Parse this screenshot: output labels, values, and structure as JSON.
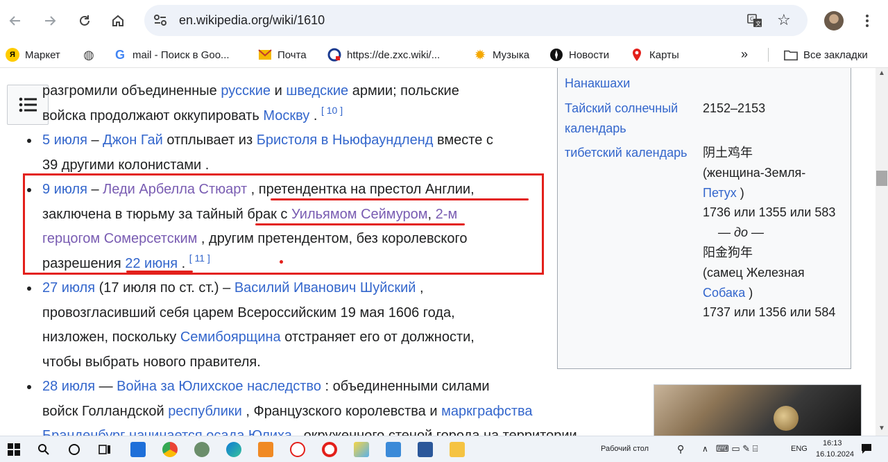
{
  "browser": {
    "url": "en.wikipedia.org/wiki/1610"
  },
  "bookmarks": [
    {
      "label": "Маркет",
      "icon": "market-icon"
    },
    {
      "label": "",
      "icon": "globe-icon"
    },
    {
      "label": "mail - Поиск в Goo...",
      "icon": "google-icon"
    },
    {
      "label": "Почта",
      "icon": "mail-icon"
    },
    {
      "label": "https://de.zxc.wiki/...",
      "icon": "zxc-icon"
    },
    {
      "label": "Музыка",
      "icon": "music-icon"
    },
    {
      "label": "Новости",
      "icon": "news-icon"
    },
    {
      "label": "Карты",
      "icon": "maps-icon"
    }
  ],
  "bookmarks_all": "Все закладки",
  "article": {
    "p0": {
      "t1": "разгромили объединенные ",
      "a1": "русские",
      "t2": " и ",
      "a2": "шведские",
      "t3": " армии; польские",
      "t4": "войска продолжают оккупировать ",
      "a3": "Москву",
      "t5": " . ",
      "ref": "[ 10 ]"
    },
    "p1": {
      "date": "5 июля",
      "t1": " – ",
      "a1": "Джон Гай",
      "t2": " отплывает из ",
      "a2": "Бристоля в Ньюфаундленд",
      "t3": " вместе с",
      "t4": "39 другими колонистами ."
    },
    "p2": {
      "date": "9 июля",
      "t1": " – ",
      "a1": "Леди Арбелла Стюарт",
      "t2": " , претендентка на престол Англии,",
      "t3": "заключена в тюрьму за тайный брак с ",
      "a2": "Уильямом Сеймуром",
      "t4": ", ",
      "a3": "2-м",
      "a3b": "герцогом Сомерсетским",
      "t5": " , другим претендентом, без королевского",
      "t6": "разрешения ",
      "a4": "22 июня",
      "t7": " . ",
      "ref": "[ 11 ]"
    },
    "p3": {
      "date": "27 июля",
      "t1": " (17 июля по ст. ст.) – ",
      "a1": "Василий Иванович Шуйский",
      "t2": " ,",
      "t3": "провозгласивший себя царем Всероссийским 19 мая 1606 года,",
      "t4": "низложен, поскольку ",
      "a2": "Семибоярщина",
      "t5": " отстраняет его от должности,",
      "t6": "чтобы выбрать нового правителя."
    },
    "p4": {
      "date": "28 июля",
      "t1": " — ",
      "a1": "Война за Юлихское наследство",
      "t2": " : объединенными силами",
      "t3": "войск Голландской ",
      "a2": "республики",
      "t4": " , Французского королевства и ",
      "a3": "маркграфства",
      "a4": "Бранденбург начинается осада Юлиха",
      "t5": " , окруженного стеной города на территории"
    }
  },
  "infobox": {
    "r0_left": "Нанакшахи",
    "r1_left": "Тайский солнечный календарь",
    "r1_right": "2152–2153",
    "r2_left": "тибетский календарь",
    "r2_right_1": "阴土鸡年",
    "r2_right_2": "(женщина-Земля-",
    "r2_right_link1": "Петух",
    "r2_right_3": " )",
    "r2_right_4": "1736 или 1355 или 583",
    "r2_right_do": "— до —",
    "r2_right_5": "阳金狗年",
    "r2_right_6": "(самец Железная",
    "r2_right_link2": "Собака",
    "r2_right_7": " )",
    "r2_right_8": "1737 или 1356 или 584"
  },
  "taskbar": {
    "desktop": "Рабочий стол",
    "lang": "ENG",
    "time": "16:13",
    "date": "16.10.2024"
  },
  "colors": {
    "link": "#3366cc",
    "visited": "#795cb2",
    "annotation": "#e3201b"
  }
}
